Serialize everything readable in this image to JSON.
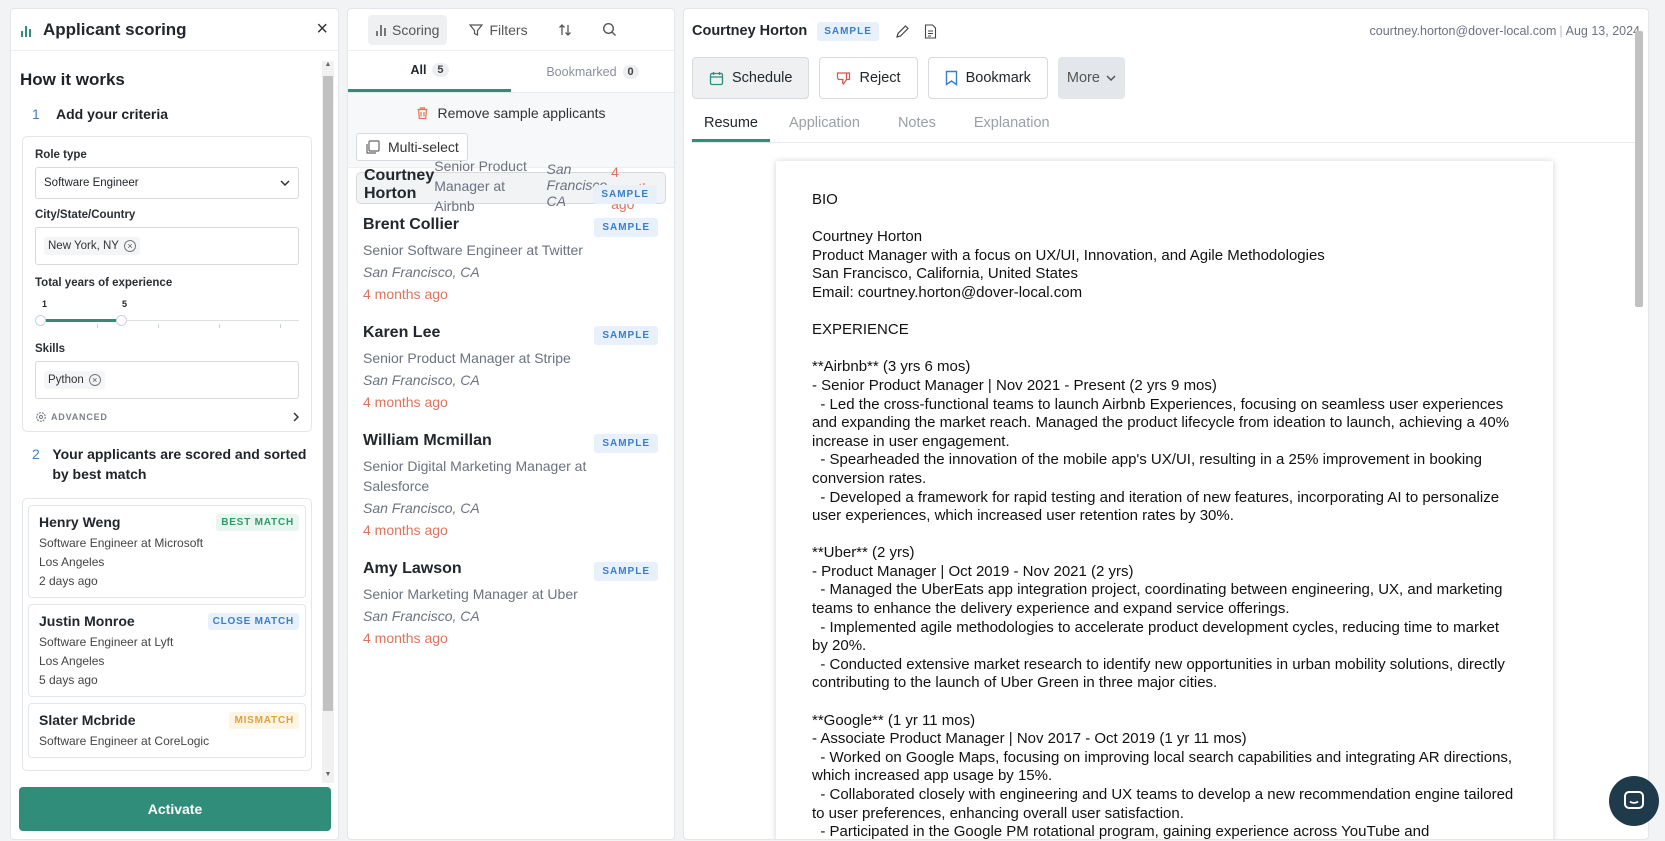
{
  "left": {
    "title": "Applicant scoring",
    "how_title": "How it works",
    "step1_num": "1",
    "step1_label": "Add your criteria",
    "role_type_label": "Role type",
    "role_type_value": "Software Engineer",
    "location_label": "City/State/Country",
    "location_chip": "New York, NY",
    "experience_label": "Total years of experience",
    "experience_min": "1",
    "experience_max": "5",
    "skills_label": "Skills",
    "skills_chip": "Python",
    "advanced_label": "ADVANCED",
    "step2_num": "2",
    "step2_label": "Your applicants are scored and sorted by best match",
    "matches": [
      {
        "name": "Henry Weng",
        "badge": "BEST MATCH",
        "title": "Software Engineer at Microsoft",
        "location": "Los Angeles",
        "time": "2 days ago"
      },
      {
        "name": "Justin Monroe",
        "badge": "CLOSE MATCH",
        "title": "Software Engineer at Lyft",
        "location": "Los Angeles",
        "time": "5 days ago"
      },
      {
        "name": "Slater Mcbride",
        "badge": "MISMATCH",
        "title": "Software Engineer at CoreLogic",
        "location": "",
        "time": ""
      }
    ],
    "activate_label": "Activate"
  },
  "mid": {
    "scoring_label": "Scoring",
    "filters_label": "Filters",
    "tab_all": "All",
    "tab_all_count": "5",
    "tab_bookmarked": "Bookmarked",
    "tab_bookmarked_count": "0",
    "remove_label": "Remove sample applicants",
    "multiselect_label": "Multi-select",
    "sample_badge": "SAMPLE",
    "applicants": [
      {
        "name": "Courtney Horton",
        "role": "Senior Product Manager at Airbnb",
        "location": "San Francisco, CA",
        "time": "4 months ago"
      },
      {
        "name": "Brent Collier",
        "role": "Senior Software Engineer at Twitter",
        "location": "San Francisco, CA",
        "time": "4 months ago"
      },
      {
        "name": "Karen Lee",
        "role": "Senior Product Manager at Stripe",
        "location": "San Francisco, CA",
        "time": "4 months ago"
      },
      {
        "name": "William Mcmillan",
        "role": "Senior Digital Marketing Manager at Salesforce",
        "location": "San Francisco, CA",
        "time": "4 months ago"
      },
      {
        "name": "Amy Lawson",
        "role": "Senior Marketing Manager at Uber",
        "location": "San Francisco, CA",
        "time": "4 months ago"
      }
    ]
  },
  "right": {
    "name": "Courtney Horton",
    "sample_badge": "SAMPLE",
    "email": "courtney.horton@dover-local.com",
    "date": "Aug 13, 2024",
    "schedule_label": "Schedule",
    "reject_label": "Reject",
    "bookmark_label": "Bookmark",
    "more_label": "More",
    "tabs": [
      "Resume",
      "Application",
      "Notes",
      "Explanation"
    ],
    "resume_text": "BIO\n\nCourtney Horton\nProduct Manager with a focus on UX/UI, Innovation, and Agile Methodologies\nSan Francisco, California, United States\nEmail: courtney.horton@dover-local.com\n\nEXPERIENCE\n\n**Airbnb** (3 yrs 6 mos)\n- Senior Product Manager | Nov 2021 - Present (2 yrs 9 mos)\n  - Led the cross-functional teams to launch Airbnb Experiences, focusing on seamless user experiences and expanding the market reach. Managed the product lifecycle from ideation to launch, achieving a 40% increase in user engagement.\n  - Spearheaded the innovation of the mobile app's UX/UI, resulting in a 25% improvement in booking conversion rates.\n  - Developed a framework for rapid testing and iteration of new features, incorporating AI to personalize user experiences, which increased user retention rates by 30%.\n\n**Uber** (2 yrs)\n- Product Manager | Oct 2019 - Nov 2021 (2 yrs)\n  - Managed the UberEats app integration project, coordinating between engineering, UX, and marketing teams to enhance the delivery experience and expand service offerings.\n  - Implemented agile methodologies to accelerate product development cycles, reducing time to market by 20%.\n  - Conducted extensive market research to identify new opportunities in urban mobility solutions, directly contributing to the launch of Uber Green in three major cities.\n\n**Google** (1 yr 11 mos)\n- Associate Product Manager | Nov 2017 - Oct 2019 (1 yr 11 mos)\n  - Worked on Google Maps, focusing on improving local search capabilities and integrating AR directions, which increased app usage by 15%.\n  - Collaborated closely with engineering and UX teams to develop a new recommendation engine tailored to user preferences, enhancing overall user satisfaction.\n  - Participated in the Google PM rotational program, gaining experience across YouTube and"
  },
  "colors": {
    "accent": "#2f8d7a",
    "sample_blue": "#3b7fc4",
    "time_red": "#e2725b",
    "mismatch_orange": "#e2a13a"
  }
}
